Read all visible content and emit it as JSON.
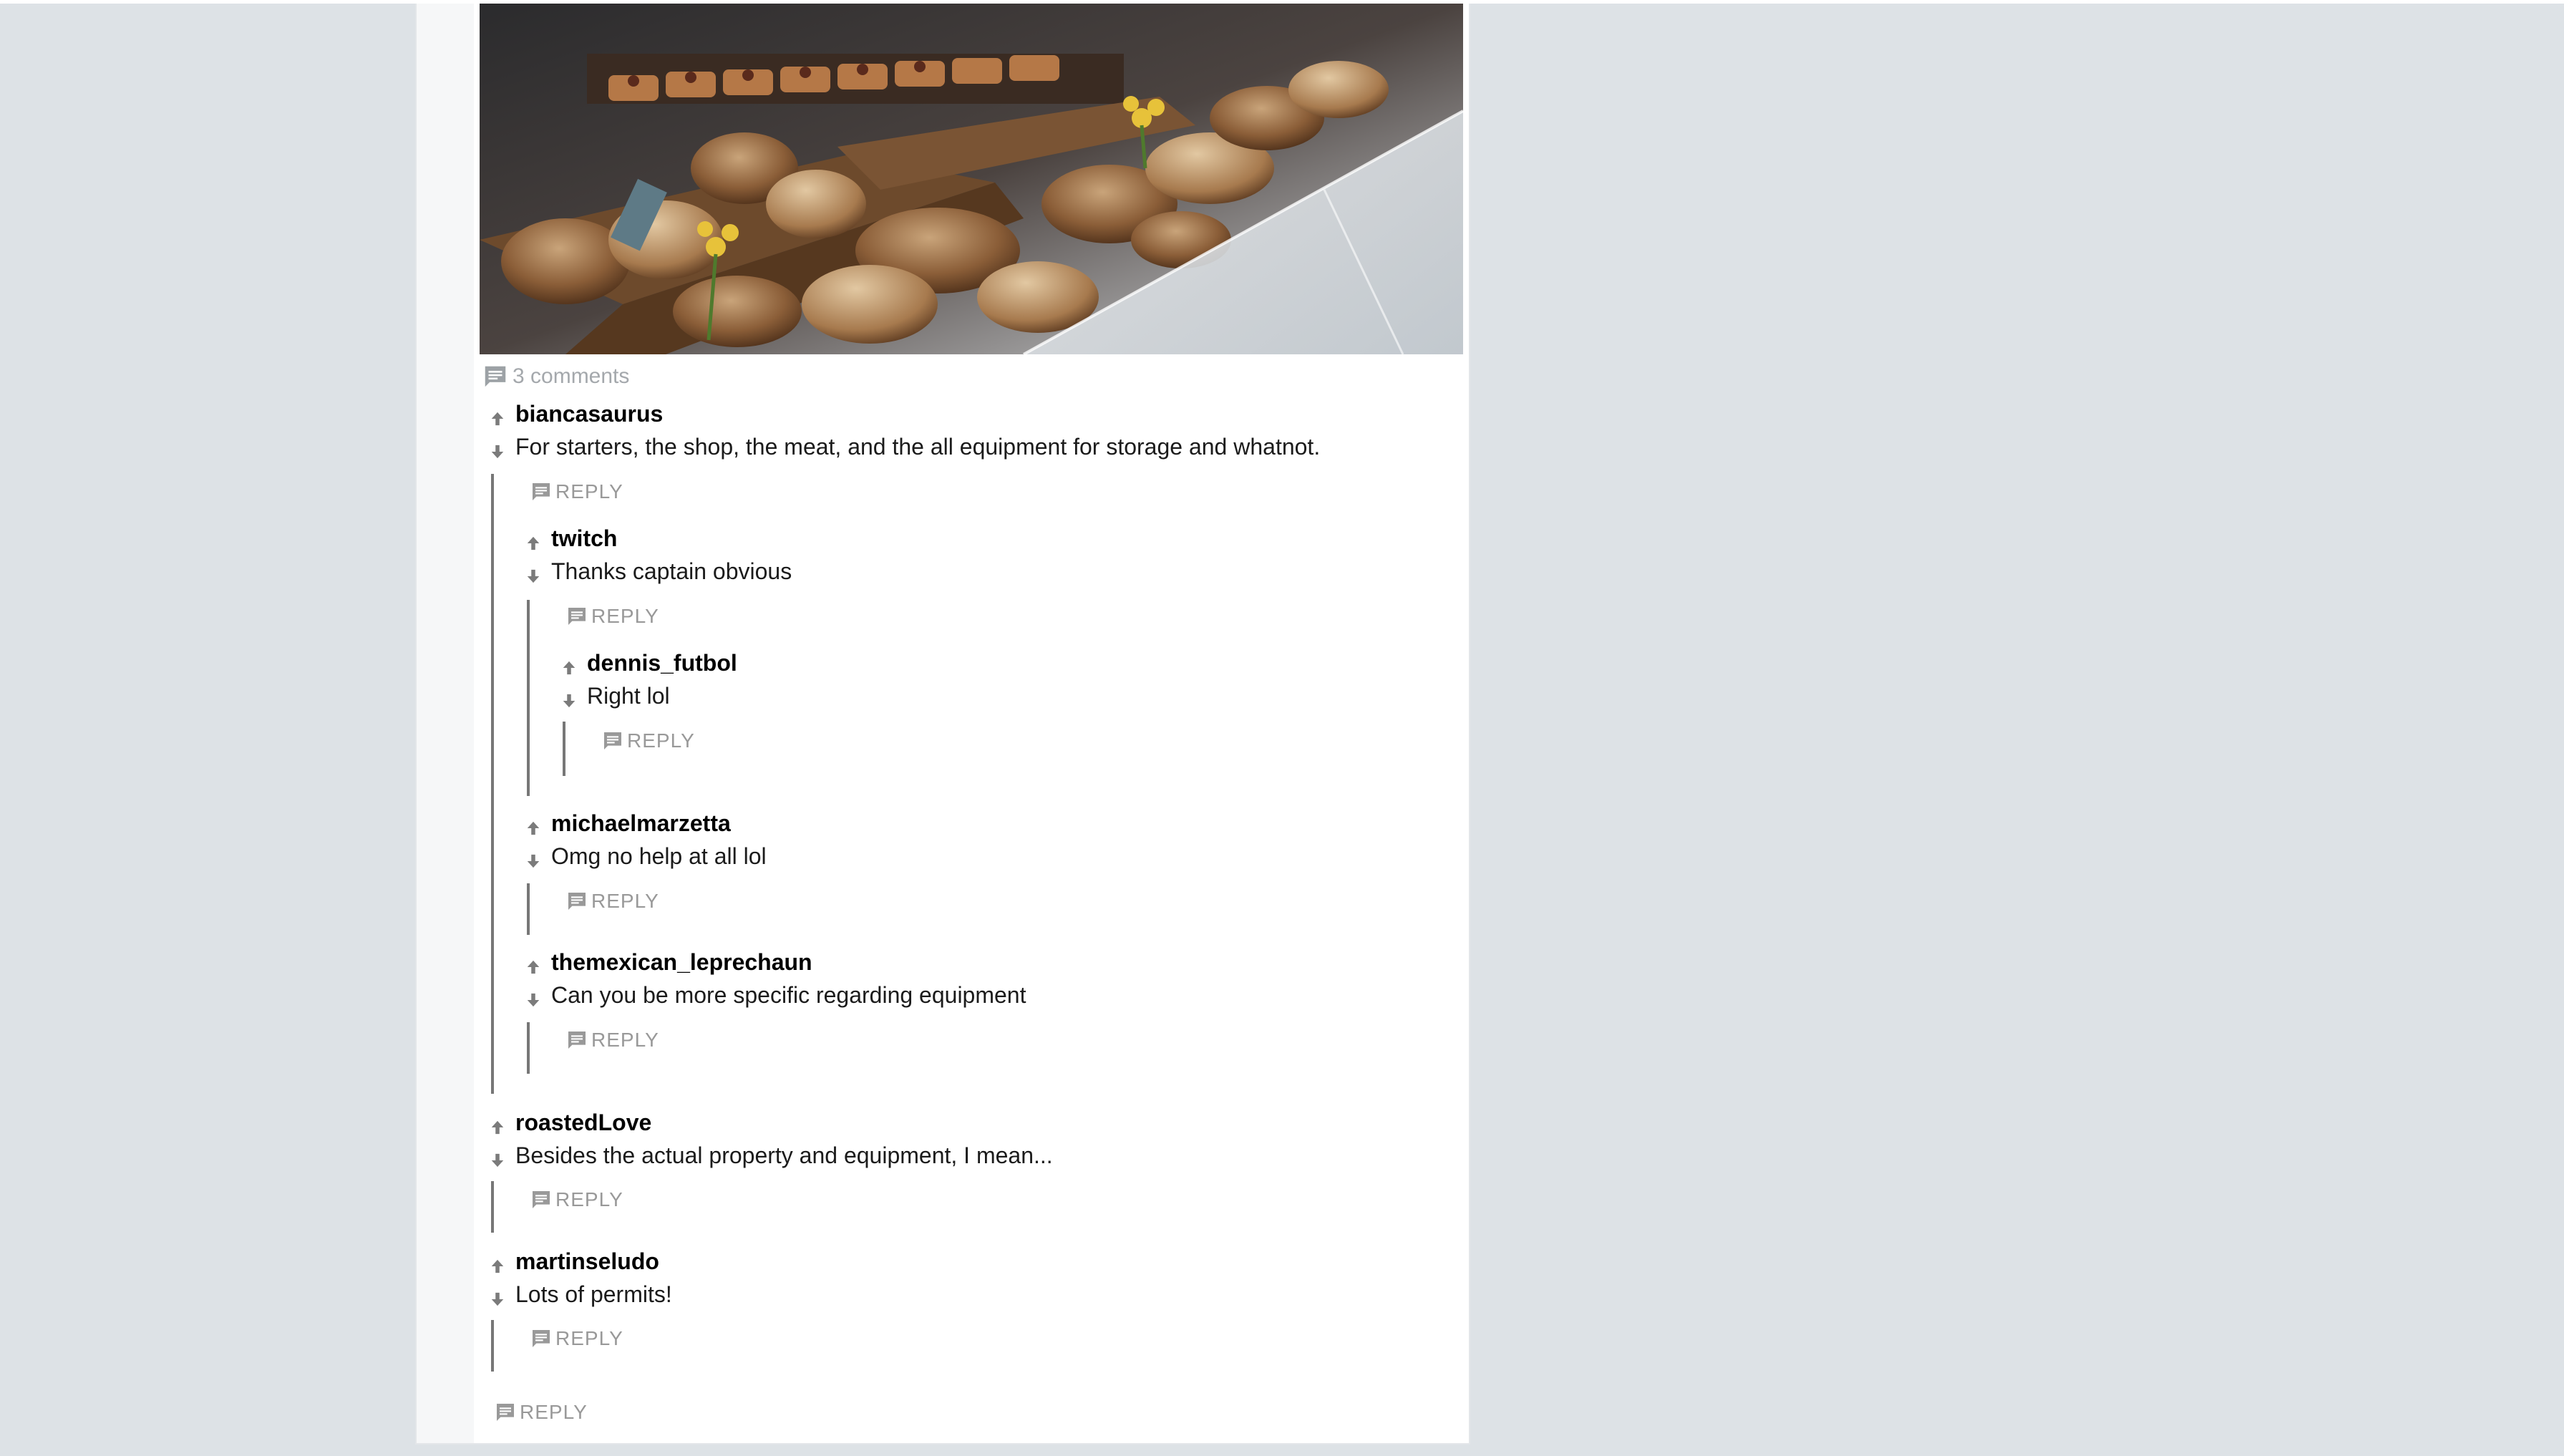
{
  "post": {
    "image_alt": "Bakery display with breads and pastries",
    "comments_count_label": "3 comments",
    "icon": "comment-icon"
  },
  "reply_label": "REPLY",
  "comments": [
    {
      "author": "biancasaurus",
      "text": "For starters, the shop, the meat, and the all equipment for storage and whatnot."
    },
    {
      "author": "twitch",
      "text": "Thanks captain obvious"
    },
    {
      "author": "dennis_futbol",
      "text": "Right lol"
    },
    {
      "author": "michaelmarzetta",
      "text": "Omg no help at all lol"
    },
    {
      "author": "themexican_leprechaun",
      "text": "Can you be more specific regarding equipment"
    },
    {
      "author": "roastedLove",
      "text": "Besides the actual property and equipment, I mean..."
    },
    {
      "author": "martinseludo",
      "text": "Lots of permits!"
    }
  ],
  "icons": {
    "upvote": "arrow-up-icon",
    "downvote": "arrow-down-icon",
    "reply": "reply-icon"
  },
  "colors": {
    "background": "#dde2e6",
    "card": "#ffffff",
    "muted": "#999999",
    "thread": "#777777"
  }
}
